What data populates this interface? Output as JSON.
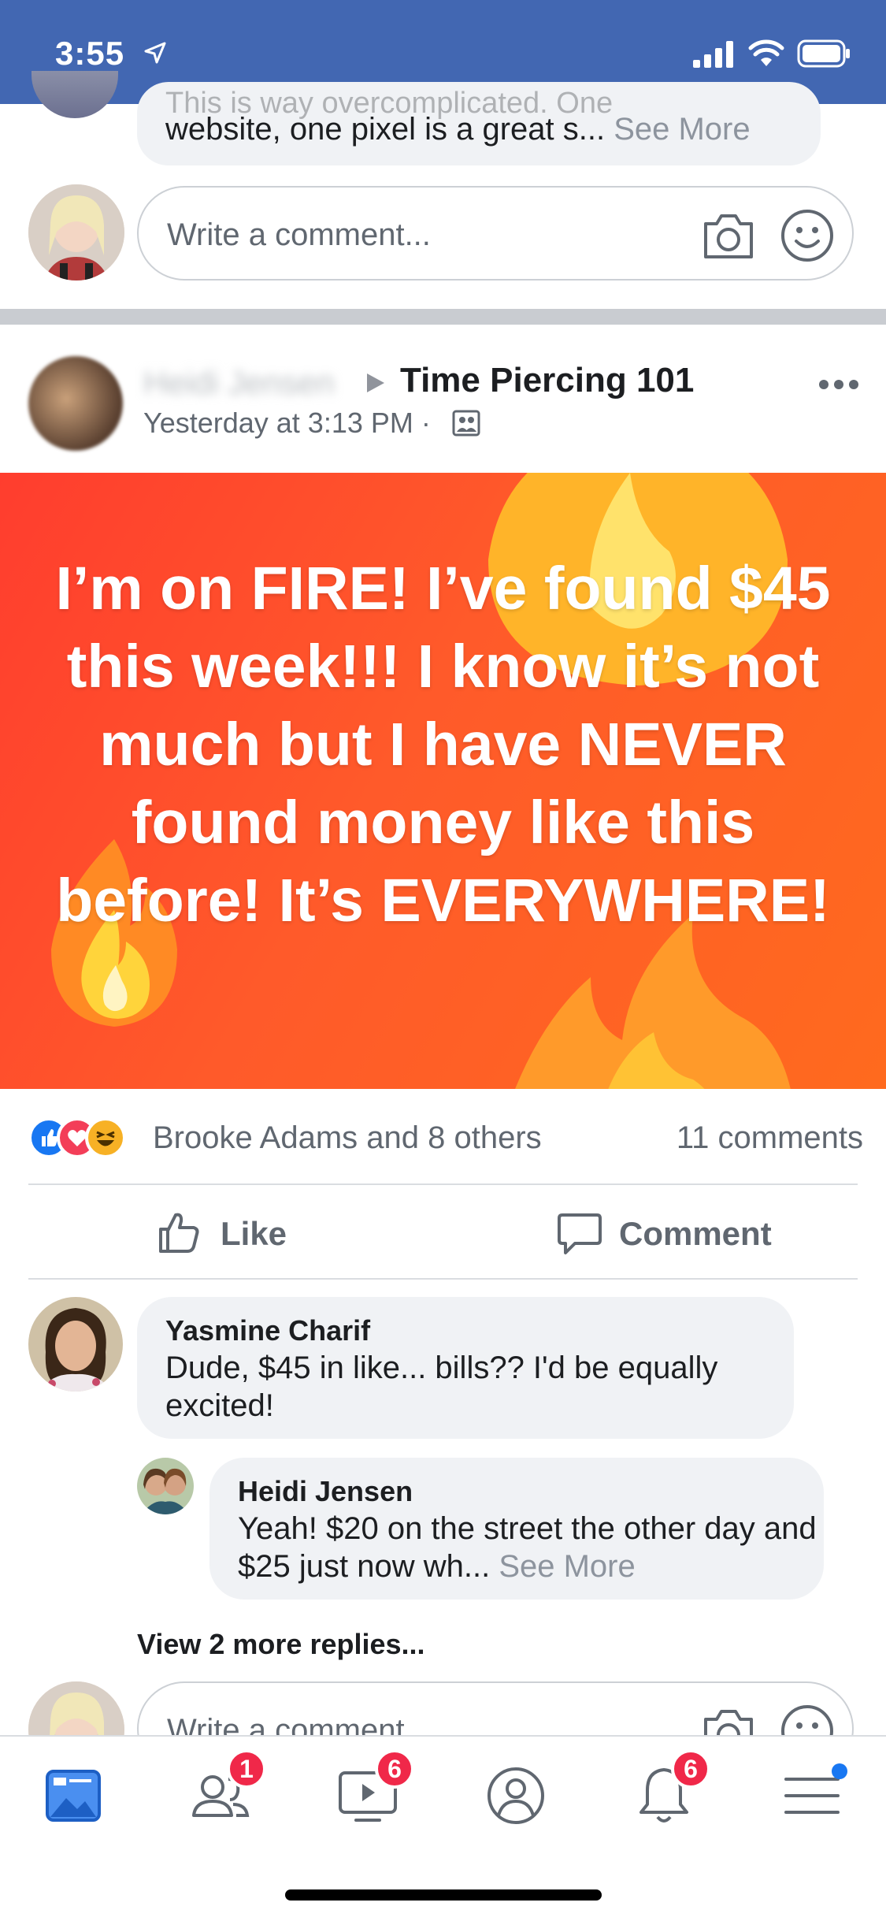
{
  "status_bar": {
    "time": "3:55"
  },
  "previous_post": {
    "hidden_line": "This is way overcomplicated. One",
    "comment_text": "website, one pixel is a great s...",
    "see_more": "See More",
    "write_placeholder": "Write a comment..."
  },
  "post": {
    "author": "Heidi Jensen",
    "group": "Time Piercing 101",
    "time": "Yesterday at 3:13 PM ·",
    "banner_text": "I’m on FIRE! I’ve found $45 this week!!! I know it’s not much but I have NEVER found money like this before! It’s EVERYWHERE!",
    "reactions_text": "Brooke Adams and 8 others",
    "comments_count": "11 comments",
    "like_label": "Like",
    "comment_label": "Comment"
  },
  "comments": [
    {
      "name": "Yasmine Charif",
      "text": "Dude, $45 in like... bills?? I'd be equally excited!"
    },
    {
      "name": "Heidi Jensen",
      "text": "Yeah! $20 on the street the other day and $25 just now wh...",
      "see_more": "See More"
    }
  ],
  "view_more_replies": "View 2 more replies...",
  "write_comment_placeholder": "Write a comment...",
  "tab_bar": {
    "items": [
      {
        "name": "news-feed",
        "badge": ""
      },
      {
        "name": "friends",
        "badge": "1"
      },
      {
        "name": "watch",
        "badge": "6"
      },
      {
        "name": "profile",
        "badge": ""
      },
      {
        "name": "notifications",
        "badge": "6"
      },
      {
        "name": "menu",
        "badge": ""
      }
    ]
  },
  "colors": {
    "brand": "#4267b2",
    "banner": "#ff4a28",
    "badge": "#f02849",
    "accent": "#1877f2"
  }
}
